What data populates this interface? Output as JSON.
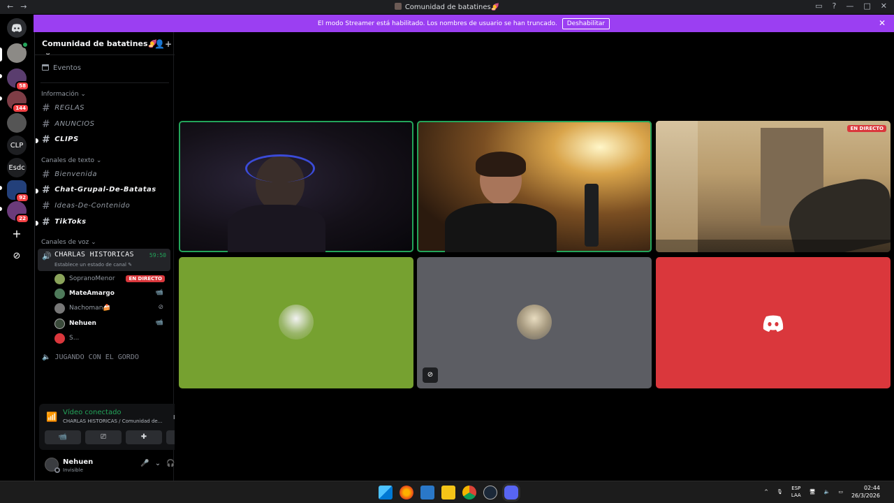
{
  "window": {
    "title": "Comunidad de batatines🍠",
    "nav_back": "←",
    "nav_forward": "→",
    "controls": [
      "▭",
      "?",
      "—",
      "□",
      "✕"
    ]
  },
  "servers": [
    {
      "label": "",
      "icon": "discord-logo-icon"
    },
    {
      "label": "",
      "badge": ""
    },
    {
      "label": "",
      "badge": "58"
    },
    {
      "label": "",
      "badge": "144"
    },
    {
      "label": "",
      "badge": ""
    },
    {
      "label": "CLP"
    },
    {
      "label": "Esdc"
    },
    {
      "label": "",
      "badge": "92"
    },
    {
      "label": "",
      "badge": "22"
    },
    {
      "label": "+",
      "icon": "add-server-icon"
    },
    {
      "label": "⊘",
      "icon": "discover-icon"
    }
  ],
  "banner": {
    "text": "El modo Streamer está habilitado. Los nombres de usuario se han truncado.",
    "button": "Deshabilitar",
    "close": "✕"
  },
  "guild": {
    "name": "Comunidad de batatines🍠",
    "chevron": "⌄",
    "add_user": "👤+",
    "events": "Eventos"
  },
  "categories": {
    "info": "Información ⌄",
    "text": "Canales de texto ⌄",
    "voice": "Canales de voz ⌄"
  },
  "info_channels": [
    {
      "name": "REGLAS",
      "unread": false
    },
    {
      "name": "ANUNCIOS",
      "unread": false
    },
    {
      "name": "CLIPS",
      "unread": true
    }
  ],
  "text_channels": [
    {
      "name": "Bienvenida",
      "unread": false
    },
    {
      "name": "Chat-Grupal-De-Batatas",
      "unread": true
    },
    {
      "name": "Ideas-De-Contenido",
      "unread": false
    },
    {
      "name": "TikToks",
      "unread": true
    }
  ],
  "voice": {
    "active_channel": "CHARLAS HISTORICAS",
    "timer": "59:50",
    "status_prompt": "Establece un estado de canal ✎",
    "users": [
      {
        "name": "SopranoMenor",
        "live": "EN DIRECTO",
        "icon": "",
        "bright": false,
        "color": "#8aa35a"
      },
      {
        "name": "MateAmargo",
        "live": "",
        "icon": "📹",
        "bright": true,
        "color": "#4e7a5a"
      },
      {
        "name": "Nachoman🍰",
        "live": "",
        "icon": "⊘",
        "bright": false,
        "color": "#777"
      },
      {
        "name": "Nehuen",
        "live": "",
        "icon": "📹",
        "bright": true,
        "color": "#3a4a3a"
      },
      {
        "name": "S...",
        "live": "",
        "icon": "",
        "bright": false,
        "color": "#da373c"
      }
    ],
    "other_channel": "JUGANDO CON EL GORDO"
  },
  "connection": {
    "title": "Vídeo conectado",
    "subtitle": "CHARLAS HISTORICAS / Comunidad de...",
    "buttons": [
      "📹",
      "⎚",
      "✚",
      "✺"
    ]
  },
  "user": {
    "name": "Nehuen",
    "status": "Invisible",
    "controls": [
      "🎤",
      "⌄",
      "🎧",
      "⌄",
      "⚙"
    ]
  },
  "stage": {
    "live_label": "EN DIRECTO",
    "mute_icon": "⊘",
    "discord_glyph": "◉"
  },
  "tiles": [
    {
      "kind": "camera",
      "user": "MateAmargo",
      "speaking": true
    },
    {
      "kind": "camera",
      "user": "Nehuen",
      "speaking": true
    },
    {
      "kind": "stream",
      "user": "SopranoMenor",
      "speaking": false
    },
    {
      "kind": "avatar",
      "user": "SopranoMenor",
      "color": "#76a130"
    },
    {
      "kind": "avatar",
      "user": "Nachoman",
      "color": "#5c5d63",
      "muted": true
    },
    {
      "kind": "avatar",
      "user": "S...",
      "color": "#da373c"
    }
  ],
  "taskbar": {
    "lang_top": "ESP",
    "lang_bottom": "LAA",
    "time": "02:44",
    "date": "26/3/2026",
    "tray_chevron": "^",
    "apps": [
      "windows-start-icon",
      "firefox-icon",
      "edge-icon",
      "file-explorer-icon",
      "chrome-icon",
      "steam-icon",
      "discord-icon"
    ]
  },
  "colors": {
    "streamer_banner": "#9b3ff2",
    "speaking_outline": "#23a55a",
    "live_red": "#da373c",
    "green_tile": "#76a130",
    "grey_tile": "#5c5d63"
  }
}
